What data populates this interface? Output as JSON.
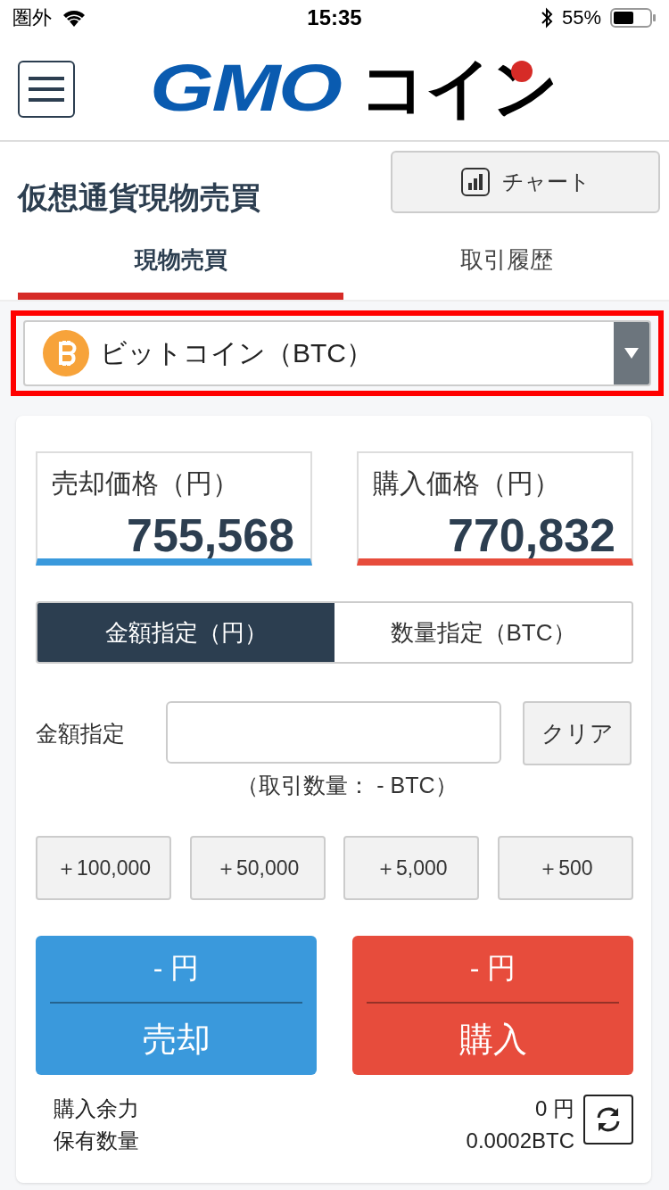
{
  "status_bar": {
    "carrier": "圏外",
    "time": "15:35",
    "battery": "55%"
  },
  "header": {
    "logo_latin": "GMO",
    "logo_kana": "コイン"
  },
  "page_title": "仮想通貨現物売買",
  "chart_button": "チャート",
  "tabs": [
    {
      "label": "現物売買",
      "selected": true
    },
    {
      "label": "取引履歴",
      "selected": false
    }
  ],
  "currency_select": {
    "value": "ビットコイン（BTC）",
    "highlighted": true
  },
  "prices": [
    {
      "label": "売却価格（円）",
      "value": "755,568",
      "color": "#3a99dc"
    },
    {
      "label": "購入価格（円）",
      "value": "770,832",
      "color": "#e74c3c"
    }
  ],
  "order_modes": [
    {
      "label": "金額指定（円）",
      "selected": true
    },
    {
      "label": "数量指定（BTC）",
      "selected": false
    }
  ],
  "amount": {
    "label": "金額指定",
    "clear_button": "クリア",
    "note": "（取引数量： - BTC）"
  },
  "presets": [
    "＋100,000",
    "＋50,000",
    "＋5,000",
    "＋500"
  ],
  "actions": [
    {
      "amount": "- 円",
      "label": "売却",
      "kind": "sell"
    },
    {
      "amount": "- 円",
      "label": "購入",
      "kind": "buy"
    }
  ],
  "balances": [
    {
      "label": "購入余力",
      "value": "0 円"
    },
    {
      "label": "保有数量",
      "value": "0.0002BTC"
    }
  ]
}
